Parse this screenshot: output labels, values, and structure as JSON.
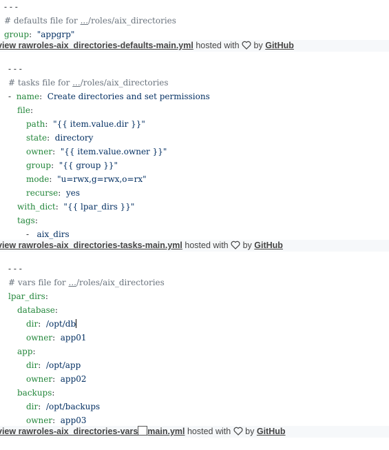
{
  "gist1": {
    "lines": [
      "- - -",
      "# defaults file for ",
      "...",
      "/roles/aix_directories",
      "group",
      ":",
      "\"appgrp\""
    ],
    "meta": {
      "view_raw": "view raw",
      "file": "roles-aix_directories-defaults-main.yml",
      "hosted": "hosted with",
      "by": "by",
      "github": "GitHub"
    }
  },
  "gist2": {
    "doc_start": "- - -",
    "comment": "# tasks file for ",
    "dots": "...",
    "path": "/roles/aix_directories",
    "dash": "-",
    "name_key": "name",
    "name_val": "Create directories and set permissions",
    "file_key": "file",
    "path_key": "path",
    "path_val": "\"{{ item.value.dir }}\"",
    "state_key": "state",
    "state_val": "directory",
    "owner_key": "owner",
    "owner_val": "\"{{ item.value.owner }}\"",
    "group_key": "group",
    "group_val": "\"{{ group }}\"",
    "mode_key": "mode",
    "mode_val": "\"u=rwx,g=rwx,o=rx\"",
    "recurse_key": "recurse",
    "recurse_val": "yes",
    "with_dict_key": "with_dict",
    "with_dict_val": "\"{{ lpar_dirs }}\"",
    "tags_key": "tags",
    "tags_item": "aix_dirs",
    "meta": {
      "view_raw": "view raw",
      "file": "roles-aix_directories-tasks-main.yml",
      "hosted": "hosted with",
      "by": "by",
      "github": "GitHub"
    }
  },
  "gist3": {
    "doc_start": "-  - -",
    "comment": "# vars file for ",
    "dots": "...",
    "path": "/roles/aix_directories",
    "lpar_dirs": "lpar_dirs",
    "database": "database",
    "dir_key": "dir",
    "owner_key": "owner",
    "db_dir": "/opt/db",
    "db_owner": "app01",
    "app": "app",
    "app_dir": "/opt/app",
    "app_owner": "app02",
    "backups": "backups",
    "backups_dir": "/opt/backups",
    "backups_owner": "app03",
    "meta": {
      "view_raw": "view raw",
      "file_a": "roles-aix_directories-vars",
      "file_b": "main.yml",
      "hosted": "hosted with",
      "by": "by",
      "github": "GitHub"
    }
  },
  "colors": {
    "key": "#22863a",
    "comment": "#6a737d",
    "string": "#032f62",
    "meta_bg": "#f6f8fa"
  }
}
